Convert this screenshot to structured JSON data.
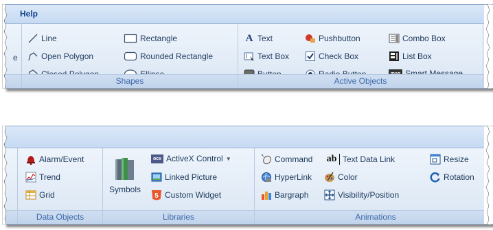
{
  "top_ribbon": {
    "tab_label": "Help",
    "shapes_group": {
      "title": "Shapes",
      "items": [
        "Line",
        "Open Polygon",
        "Closed Polygon",
        "Rectangle",
        "Rounded Rectangle",
        "Ellipse"
      ]
    },
    "active_objects_group": {
      "title": "Active Objects",
      "items": [
        "Text",
        "Text Box",
        "Button",
        "Pushbutton",
        "Check Box",
        "Radio Button",
        "Combo Box",
        "List Box",
        "Smart Message"
      ]
    },
    "cut_fragment": "e"
  },
  "bottom_ribbon": {
    "data_objects_group": {
      "title": "Data Objects",
      "items": [
        "Alarm/Event",
        "Trend",
        "Grid"
      ]
    },
    "libraries_group": {
      "title": "Libraries",
      "symbols_label": "Symbols",
      "items": [
        "ActiveX Control",
        "Linked Picture",
        "Custom Widget"
      ]
    },
    "animations_group": {
      "title": "Animations",
      "items": [
        "Command",
        "HyperLink",
        "Bargraph",
        "Text Data Link",
        "Color",
        "Visibility/Position",
        "Resize",
        "Rotation"
      ]
    }
  },
  "icon_glyphs": {
    "text_icon": "A",
    "smart_message_icon": "msg",
    "activex_icon": "ocx",
    "text_data_link_icon": "ab"
  },
  "colors": {
    "ribbon_text": "#1e395b",
    "group_title": "#3e6aaa",
    "tab_text": "#15428b",
    "accent_orange": "#e8572a"
  }
}
